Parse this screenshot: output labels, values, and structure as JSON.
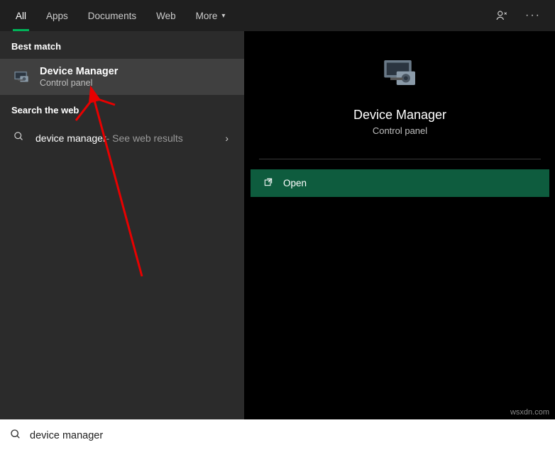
{
  "tabs": {
    "all": "All",
    "apps": "Apps",
    "documents": "Documents",
    "web": "Web",
    "more": "More"
  },
  "left": {
    "best_match": "Best match",
    "result_title": "Device Manager",
    "result_sub": "Control panel",
    "search_web": "Search the web",
    "web_query": "device manager",
    "web_suffix": " - See web results"
  },
  "right": {
    "title": "Device Manager",
    "sub": "Control panel",
    "open": "Open"
  },
  "search": {
    "value": "device manager"
  },
  "watermark": "wsxdn.com"
}
